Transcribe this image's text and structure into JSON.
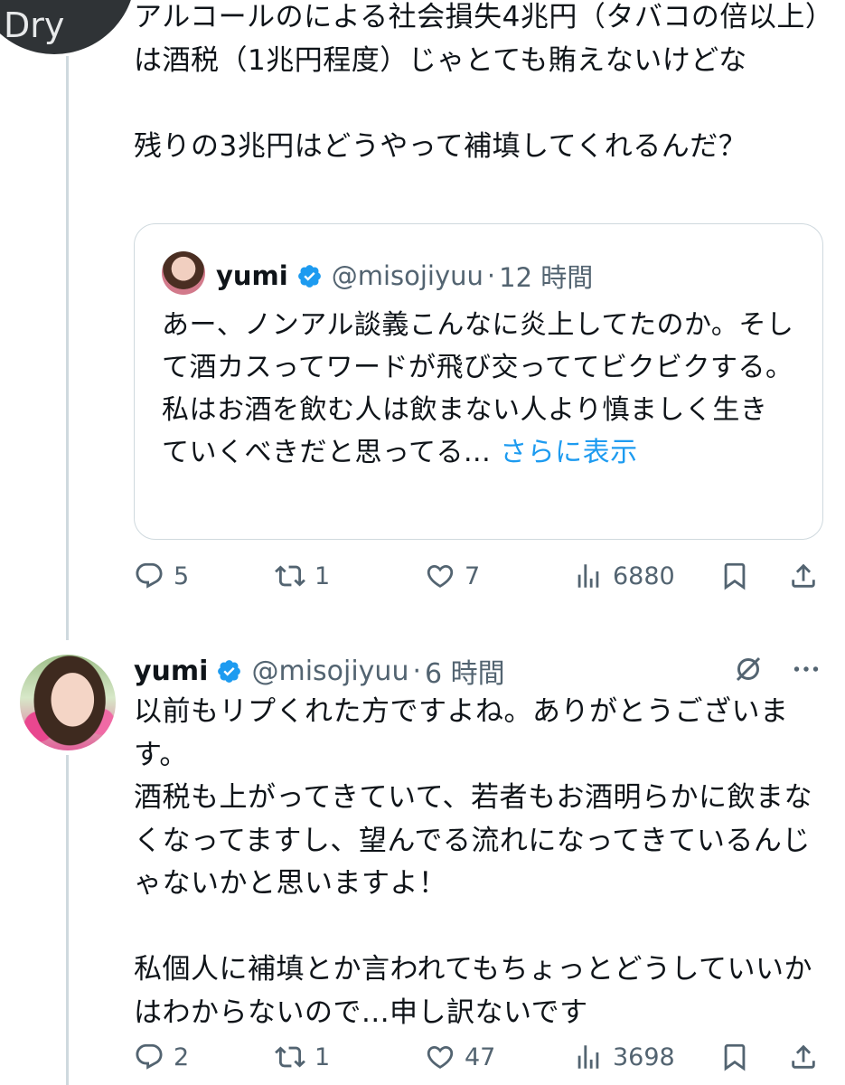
{
  "reply_top": {
    "avatar_text": "Dry",
    "body": "アルコールのによる社会損失4兆円（タバコの倍以上）は酒税（1兆円程度）じゃとても賄えないけどな\n\n残りの3兆円はどうやって補填してくれるんだ？",
    "quoted": {
      "name": "yumi",
      "handle": "@misojiyuu",
      "dot": "·",
      "time": "12 時間",
      "text": "あー、ノンアル談義こんなに炎上してたのか。そして酒カスってワードが飛び交っててビクビクする。\n私はお酒を飲む人は飲まない人より慎ましく生きていくべきだと思ってる...",
      "show_more": "さらに表示"
    },
    "actions": {
      "replies": "5",
      "reposts": "1",
      "likes": "7",
      "views": "6880"
    }
  },
  "reply_main": {
    "name": "yumi",
    "handle": "@misojiyuu",
    "dot": "·",
    "time": "6 時間",
    "body": "以前もリプくれた方ですよね。ありがとうございます。\n酒税も上がってきていて、若者もお酒明らかに飲まなくなってますし、望んでる流れになってきているんじゃないかと思いますよ！\n\n私個人に補填とか言われてもちょっとどうしていいかはわからないので...申し訳ないです",
    "actions": {
      "replies": "2",
      "reposts": "1",
      "likes": "47",
      "views": "3698"
    }
  },
  "icons": {
    "reply": "reply-icon",
    "repost": "repost-icon",
    "like": "like-icon",
    "views": "views-icon",
    "bookmark": "bookmark-icon",
    "share": "share-icon",
    "verified": "verified-badge-icon",
    "grok": "grok-icon",
    "more": "more-icon"
  },
  "colors": {
    "text": "#0f1419",
    "secondary": "#536471",
    "link": "#1d9bf0",
    "border": "#cfd9de"
  }
}
